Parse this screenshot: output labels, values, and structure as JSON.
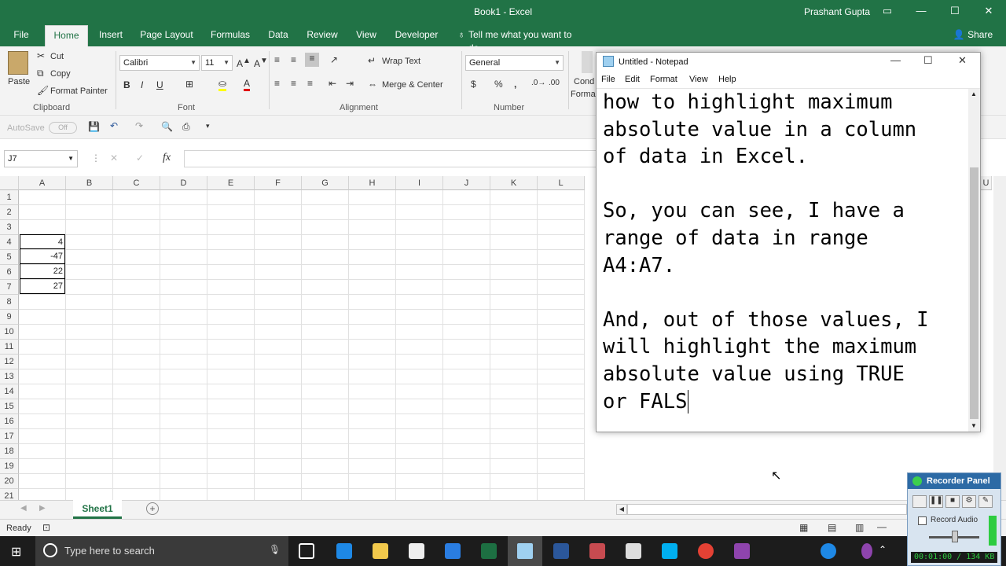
{
  "excel": {
    "window_title": "Book1 - Excel",
    "user_name": "Prashant Gupta",
    "tabs": [
      "File",
      "Home",
      "Insert",
      "Page Layout",
      "Formulas",
      "Data",
      "Review",
      "View",
      "Developer"
    ],
    "tell_me": "Tell me what you want to do",
    "share": "Share",
    "clipboard": {
      "paste": "Paste",
      "cut": "Cut",
      "copy": "Copy",
      "format_painter": "Format Painter",
      "label": "Clipboard"
    },
    "font": {
      "name": "Calibri",
      "size": "11",
      "label": "Font",
      "bold": "B",
      "italic": "I",
      "underline": "U"
    },
    "alignment": {
      "wrap_text": "Wrap Text",
      "merge_center": "Merge & Center",
      "label": "Alignment"
    },
    "number": {
      "format": "General",
      "label": "Number",
      "currency": "$",
      "percent": "%",
      "comma": ","
    },
    "cond_format": {
      "line1": "Cond",
      "line2": "Forma"
    },
    "autosave": "AutoSave",
    "autosave_state": "Off",
    "name_box": "J7",
    "fx": "fx",
    "columns": [
      "A",
      "B",
      "C",
      "D",
      "E",
      "F",
      "G",
      "H",
      "I",
      "J",
      "K",
      "L",
      "U"
    ],
    "rows": [
      "1",
      "2",
      "3",
      "4",
      "5",
      "6",
      "7",
      "8",
      "9",
      "10",
      "11",
      "12",
      "13",
      "14",
      "15",
      "16",
      "17",
      "18",
      "19",
      "20",
      "21"
    ],
    "cells": [
      {
        "ref": "A4",
        "value": "4"
      },
      {
        "ref": "A5",
        "value": "-47"
      },
      {
        "ref": "A6",
        "value": "22"
      },
      {
        "ref": "A7",
        "value": "27"
      }
    ],
    "sheet_tab": "Sheet1",
    "status": "Ready"
  },
  "notepad": {
    "title": "Untitled - Notepad",
    "menu": [
      "File",
      "Edit",
      "Format",
      "View",
      "Help"
    ],
    "text": "how to highlight maximum\nabsolute value in a column\nof data in Excel.\n\nSo, you can see, I have a\nrange of data in range\nA4:A7.\n\nAnd, out of those values, I\nwill highlight the maximum\nabsolute value using TRUE\nor FALS"
  },
  "taskbar": {
    "search_placeholder": "Type here to search"
  },
  "recorder": {
    "title": "Recorder Panel",
    "record_audio": "Record Audio",
    "status": "00:01:00 / 134 KB"
  },
  "colors": {
    "excel_green": "#217346",
    "taskbar": "#1c1c1c",
    "recorder_blue": "#2c6aa5"
  }
}
